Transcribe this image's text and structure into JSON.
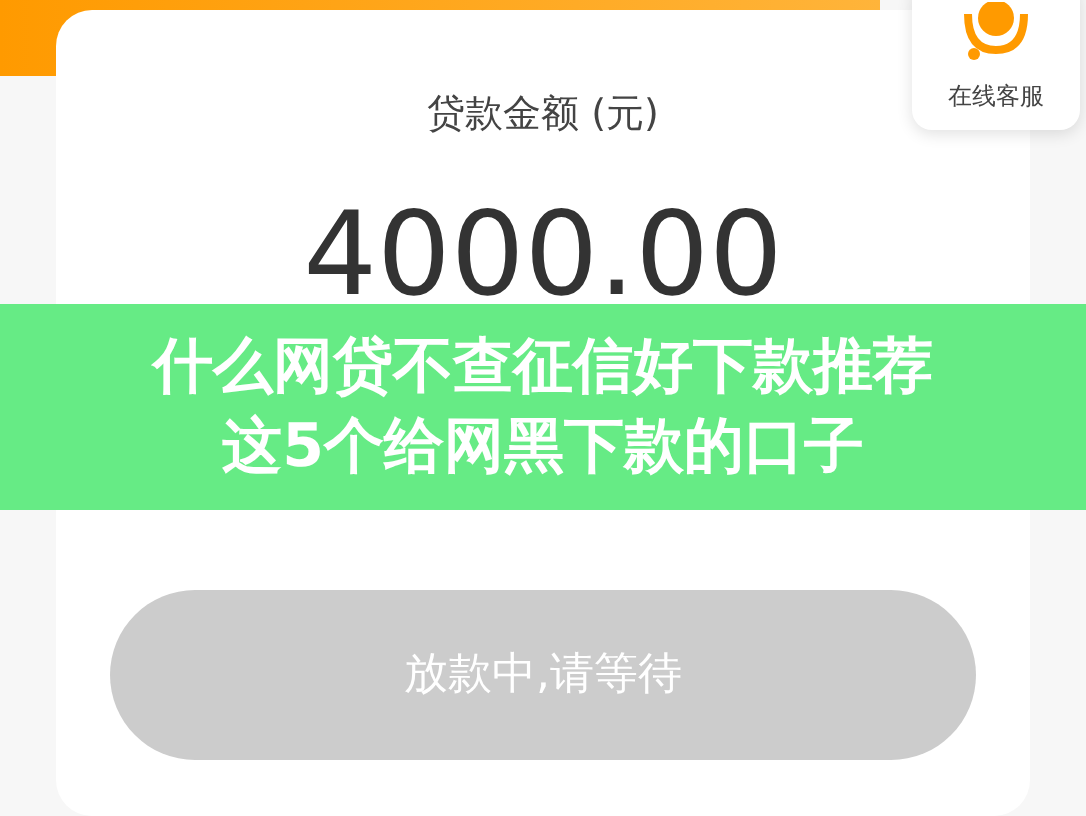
{
  "loan_card": {
    "label": "贷款金额 (元)",
    "amount": "4000.00"
  },
  "service": {
    "label": "在线客服"
  },
  "banner": {
    "lines": [
      "什么网贷不查征信好下款推荐",
      "这5个给网黑下款的口子"
    ]
  },
  "action_button": {
    "label": "放款中,请等待",
    "disabled": true
  }
}
